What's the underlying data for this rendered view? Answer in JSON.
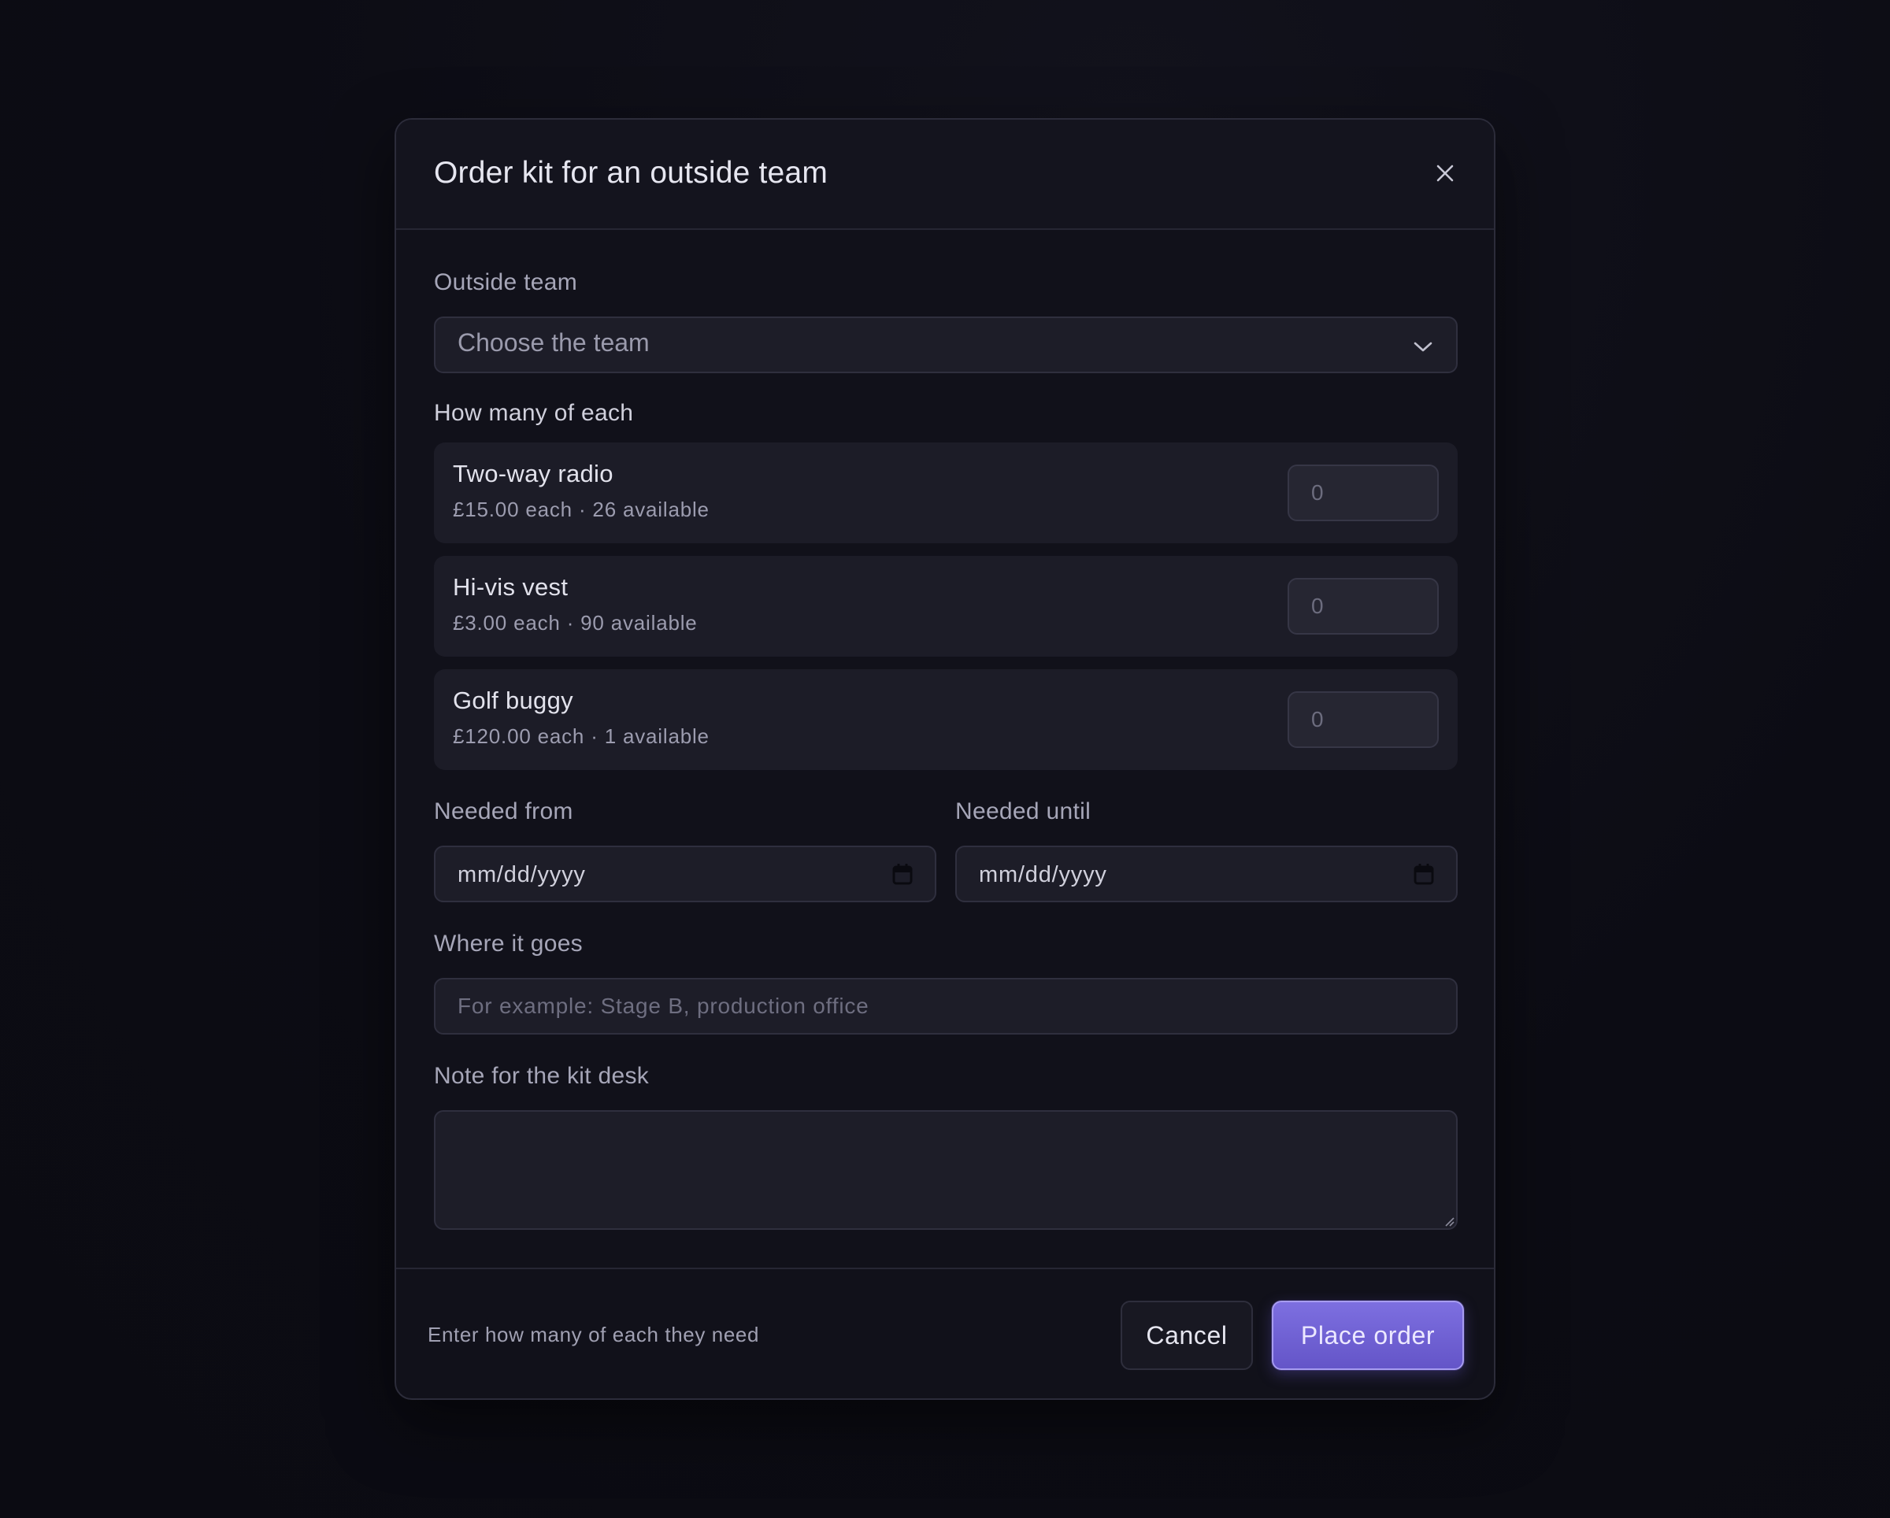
{
  "dialog": {
    "title": "Order kit for an outside team",
    "close_icon": "close-icon"
  },
  "team": {
    "label": "Outside team",
    "placeholder": "Choose the team",
    "icon": "chevron-down-icon"
  },
  "items_section": {
    "label": "How many of each",
    "items": [
      {
        "name": "Two-way radio",
        "meta": "£15.00 each · 26 available",
        "placeholder": "0"
      },
      {
        "name": "Hi-vis vest",
        "meta": "£3.00 each · 90 available",
        "placeholder": "0"
      },
      {
        "name": "Golf buggy",
        "meta": "£120.00 each · 1 available",
        "placeholder": "0"
      }
    ]
  },
  "dates": {
    "from_label": "Needed from",
    "from_value": "mm/dd/yyyy",
    "until_label": "Needed until",
    "until_value": "mm/dd/yyyy",
    "icon": "calendar-icon"
  },
  "location": {
    "label": "Where it goes",
    "placeholder": "For example: Stage B, production office"
  },
  "note": {
    "label": "Note for the kit desk"
  },
  "footer": {
    "hint": "Enter how many of each they need",
    "cancel_label": "Cancel",
    "submit_label": "Place order"
  },
  "colors": {
    "background": "#0c0c14",
    "dialog": "#11111a",
    "accent": "#6f61d6"
  }
}
